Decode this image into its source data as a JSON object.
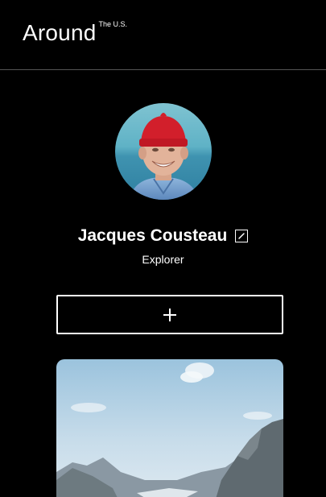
{
  "header": {
    "logo_main": "Around",
    "logo_sup": "The U.S."
  },
  "profile": {
    "name": "Jacques Cousteau",
    "job": "Explorer",
    "avatar_icon": "avatar-photo",
    "edit_icon": "pencil-icon",
    "add_icon": "plus-icon"
  },
  "colors": {
    "background": "#000000",
    "text": "#ffffff",
    "divider": "#545454"
  }
}
